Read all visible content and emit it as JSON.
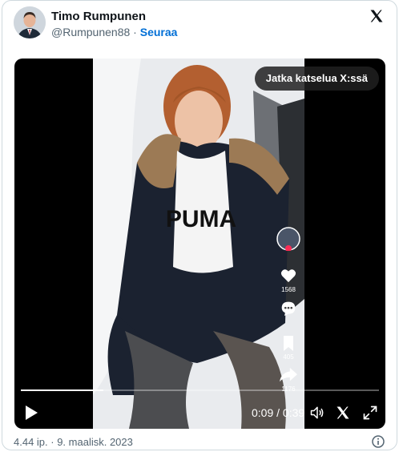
{
  "author": {
    "name": "Timo Rumpunen",
    "handle": "@Rumpunen88",
    "separator": "·",
    "follow_label": "Seuraa"
  },
  "video": {
    "continue_label": "Jatka katselua X:ssä",
    "current_time": "0:09",
    "time_separator": " / ",
    "duration": "0:39",
    "progress": 0.23,
    "shirt_text": "PUMA",
    "tiktok": {
      "likes": "1568",
      "bookmarks": "405",
      "shares": "1176"
    }
  },
  "footer": {
    "timestamp": "4.44 ip. · 9. maalisk. 2023"
  },
  "icons": {
    "header_logo": "x-logo-icon",
    "play": "play-icon",
    "volume": "volume-icon",
    "x_small": "x-logo-icon",
    "fullscreen": "fullscreen-icon",
    "info": "info-icon"
  }
}
